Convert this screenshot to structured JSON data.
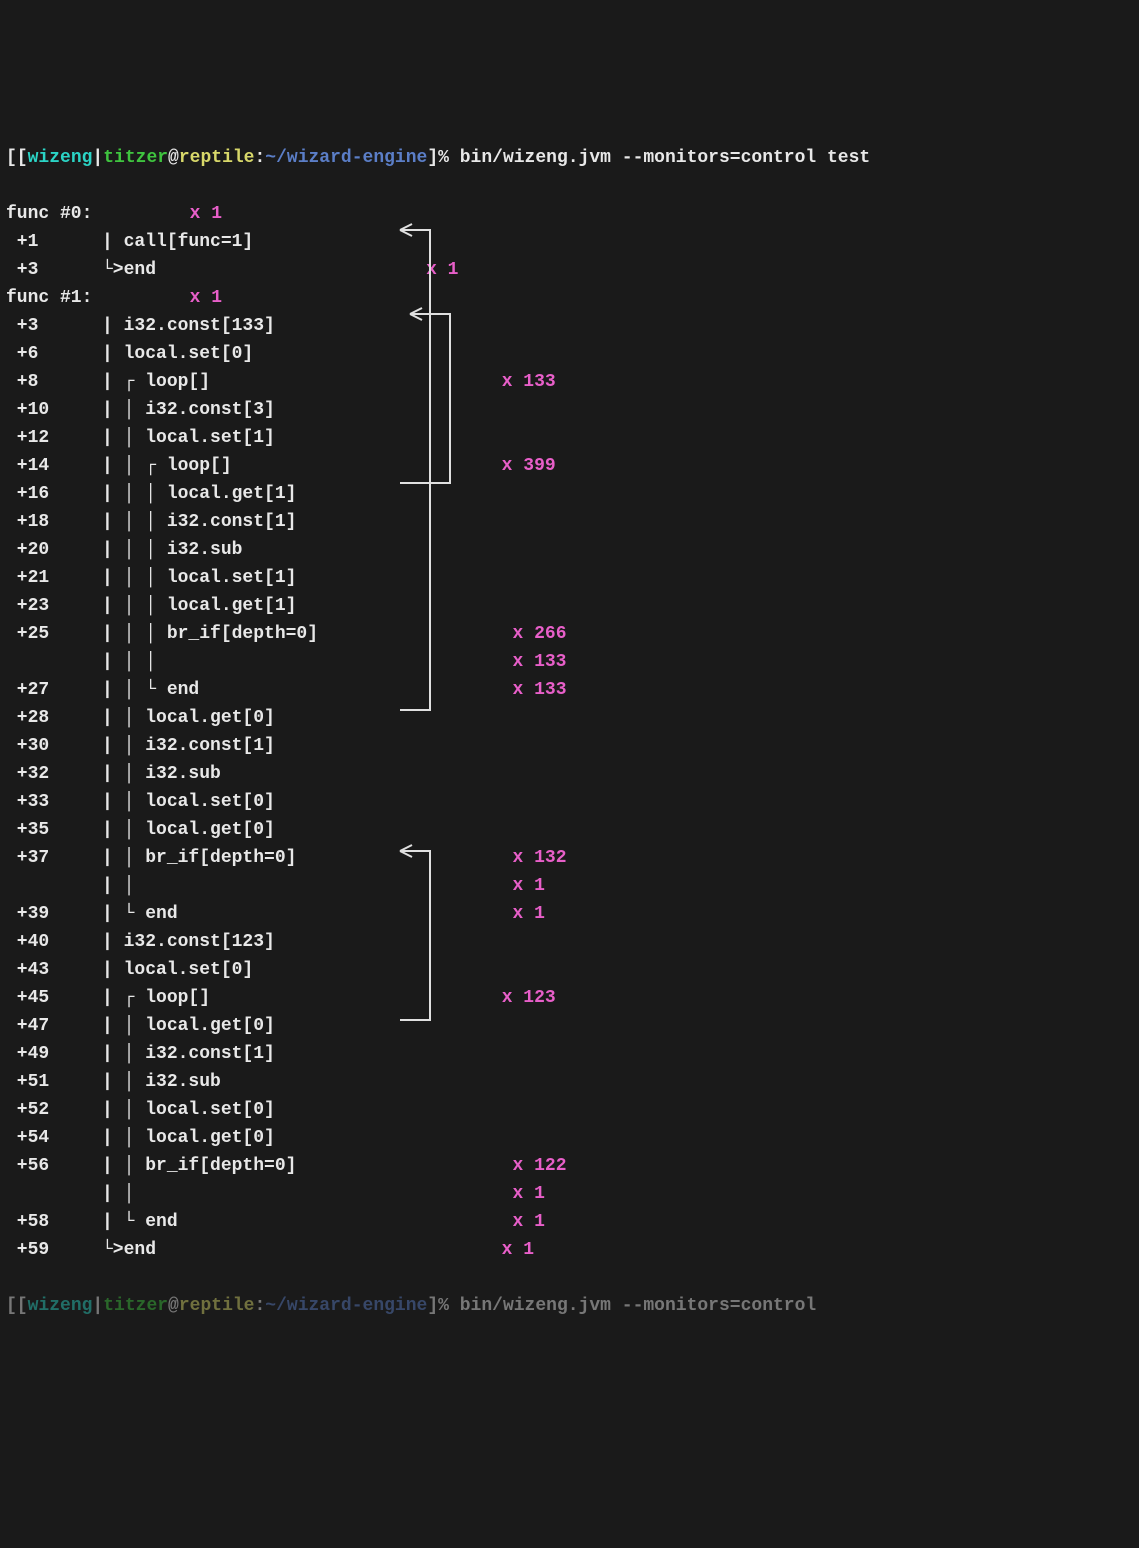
{
  "prompt": {
    "lbracket1": "[[",
    "proj": "wizeng",
    "pipe": "|",
    "user": "titzer",
    "at": "@",
    "host": "reptile",
    "colon": ":",
    "path": "~/wizard-engine",
    "rbracket": "]%",
    "cmd": " bin/wizeng.jvm --monitors=control test"
  },
  "lines": [
    {
      "offset": "func #0:",
      "tree": "",
      "instr": "",
      "count": "x 1",
      "funcHeader": true
    },
    {
      "offset": " +1",
      "tree": "| ",
      "instr": "call[func=1]",
      "count": ""
    },
    {
      "offset": " +3",
      "tree": "└>",
      "instr": "end",
      "count": "x 1",
      "countPad": "                         "
    },
    {
      "offset": "func #1:",
      "tree": "",
      "instr": "",
      "count": "x 1",
      "funcHeader": true
    },
    {
      "offset": " +3",
      "tree": "| ",
      "instr": "i32.const[133]",
      "count": ""
    },
    {
      "offset": " +6",
      "tree": "| ",
      "instr": "local.set[0]",
      "count": ""
    },
    {
      "offset": " +8",
      "tree": "| ┌ ",
      "instr": "loop[]",
      "count": "x 133",
      "arrow": "left",
      "countPad": "                           "
    },
    {
      "offset": " +10",
      "tree": "| │ ",
      "instr": "i32.const[3]",
      "count": ""
    },
    {
      "offset": " +12",
      "tree": "| │ ",
      "instr": "local.set[1]",
      "count": ""
    },
    {
      "offset": " +14",
      "tree": "| │ ┌ ",
      "instr": "loop[]",
      "count": "x 399",
      "arrow": "left",
      "countPad": "                         "
    },
    {
      "offset": " +16",
      "tree": "| │ │ ",
      "instr": "local.get[1]",
      "count": ""
    },
    {
      "offset": " +18",
      "tree": "| │ │ ",
      "instr": "i32.const[1]",
      "count": ""
    },
    {
      "offset": " +20",
      "tree": "| │ │ ",
      "instr": "i32.sub",
      "count": ""
    },
    {
      "offset": " +21",
      "tree": "| │ │ ",
      "instr": "local.set[1]",
      "count": ""
    },
    {
      "offset": " +23",
      "tree": "| │ │ ",
      "instr": "local.get[1]",
      "count": ""
    },
    {
      "offset": " +25",
      "tree": "| │ │ ",
      "instr": "br_if[depth=0]",
      "count": "x 266",
      "countPad": "                  "
    },
    {
      "offset": "",
      "tree": "| │ │ ",
      "instr": "",
      "count": "x 133",
      "countPad": "                                "
    },
    {
      "offset": " +27",
      "tree": "| │ └ ",
      "instr": "end",
      "count": "x 133",
      "countPad": "                             "
    },
    {
      "offset": " +28",
      "tree": "| │ ",
      "instr": "local.get[0]",
      "count": ""
    },
    {
      "offset": " +30",
      "tree": "| │ ",
      "instr": "i32.const[1]",
      "count": ""
    },
    {
      "offset": " +32",
      "tree": "| │ ",
      "instr": "i32.sub",
      "count": ""
    },
    {
      "offset": " +33",
      "tree": "| │ ",
      "instr": "local.set[0]",
      "count": ""
    },
    {
      "offset": " +35",
      "tree": "| │ ",
      "instr": "local.get[0]",
      "count": ""
    },
    {
      "offset": " +37",
      "tree": "| │ ",
      "instr": "br_if[depth=0]",
      "count": "x 132",
      "countPad": "                    "
    },
    {
      "offset": "",
      "tree": "| │ ",
      "instr": "",
      "count": "x 1",
      "countPad": "                                  "
    },
    {
      "offset": " +39",
      "tree": "| └ ",
      "instr": "end",
      "count": "x 1",
      "countPad": "                               "
    },
    {
      "offset": " +40",
      "tree": "| ",
      "instr": "i32.const[123]",
      "count": ""
    },
    {
      "offset": " +43",
      "tree": "| ",
      "instr": "local.set[0]",
      "count": ""
    },
    {
      "offset": " +45",
      "tree": "| ┌ ",
      "instr": "loop[]",
      "count": "x 123",
      "arrow": "left",
      "countPad": "                           "
    },
    {
      "offset": " +47",
      "tree": "| │ ",
      "instr": "local.get[0]",
      "count": ""
    },
    {
      "offset": " +49",
      "tree": "| │ ",
      "instr": "i32.const[1]",
      "count": ""
    },
    {
      "offset": " +51",
      "tree": "| │ ",
      "instr": "i32.sub",
      "count": ""
    },
    {
      "offset": " +52",
      "tree": "| │ ",
      "instr": "local.set[0]",
      "count": ""
    },
    {
      "offset": " +54",
      "tree": "| │ ",
      "instr": "local.get[0]",
      "count": ""
    },
    {
      "offset": " +56",
      "tree": "| │ ",
      "instr": "br_if[depth=0]",
      "count": "x 122",
      "countPad": "                    "
    },
    {
      "offset": "",
      "tree": "| │ ",
      "instr": "",
      "count": "x 1",
      "countPad": "                                  "
    },
    {
      "offset": " +58",
      "tree": "| └ ",
      "instr": "end",
      "count": "x 1",
      "countPad": "                               "
    },
    {
      "offset": " +59",
      "tree": "└>",
      "instr": "end",
      "count": "x 1",
      "countPad": "                                "
    }
  ],
  "prompt2": {
    "lbracket1": "[[",
    "proj": "wizeng",
    "pipe": "|",
    "user": "titzer",
    "at": "@",
    "host": "reptile",
    "colon": ":",
    "path": "~/wizard-engine",
    "rbracket": "]%",
    "cmd": " bin/wizeng.jvm --monitors=control"
  },
  "colors": {
    "cyan": "#2bd4c5",
    "green": "#3fc43f",
    "yellow": "#d8d86a",
    "blue": "#5b7ec7",
    "magenta": "#e85fc9"
  }
}
